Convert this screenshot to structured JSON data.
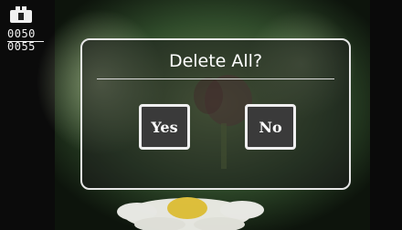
{
  "status": {
    "camera_icon": "camera-icon",
    "counter_current": "0050",
    "counter_total": "0055"
  },
  "dialog": {
    "title": "Delete All?",
    "yes_label": "Yes",
    "no_label": "No"
  },
  "colors": {
    "dialog_border": "#e6e6e6",
    "button_fill": "#3a3a3a",
    "text": "#ffffff"
  }
}
